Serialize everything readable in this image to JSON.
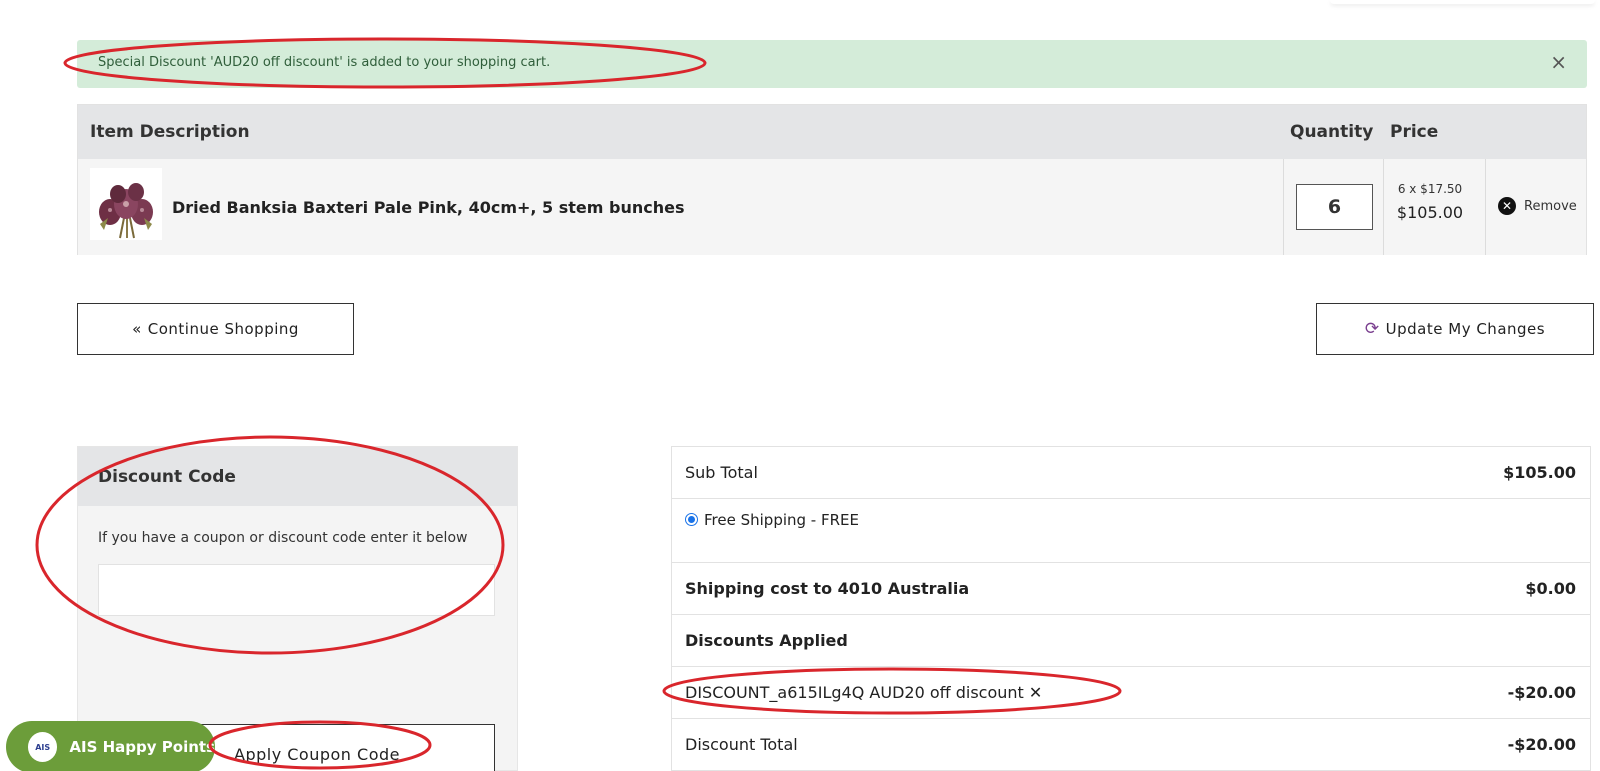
{
  "alert": {
    "message": "Special Discount 'AUD20 off discount' is added to your shopping cart.",
    "close_icon": "×"
  },
  "cart": {
    "headers": {
      "description": "Item Description",
      "quantity": "Quantity",
      "price": "Price"
    },
    "item": {
      "name": "Dried Banksia Baxteri Pale Pink, 40cm+, 5 stem bunches",
      "image_icon": "banksia-flower-bunch",
      "quantity": "6",
      "unit_price": "6 x $17.50",
      "line_total": "$105.00",
      "remove_label": "Remove",
      "remove_icon": "circle-x-icon"
    }
  },
  "actions": {
    "continue_label": "Continue Shopping",
    "continue_icon": "«",
    "update_label": "Update My Changes",
    "update_icon": "refresh-icon"
  },
  "discount": {
    "title": "Discount Code",
    "help": "If you have a coupon or discount code enter it below",
    "input_value": "",
    "apply_label": "Apply Coupon Code"
  },
  "totals": {
    "subtotal_label": "Sub Total",
    "subtotal_value": "$105.00",
    "shipping_option": "Free Shipping - FREE",
    "shipping_cost_label": "Shipping cost to 4010 Australia",
    "shipping_cost_value": "$0.00",
    "discounts_applied_label": "Discounts Applied",
    "discount_line_label": "DISCOUNT_a615ILg4Q AUD20 off discount",
    "discount_line_value": "-$20.00",
    "discount_total_label": "Discount Total",
    "discount_total_value": "-$20.00"
  },
  "happy_points": {
    "label": "AIS Happy Points",
    "logo_text": "AIS"
  },
  "colors": {
    "alert_bg": "#d4ecd9",
    "header_bg": "#e4e5e7",
    "annotation_red": "#d9262c",
    "happy_green": "#6c9d3a",
    "radio_blue": "#1a73e8"
  }
}
